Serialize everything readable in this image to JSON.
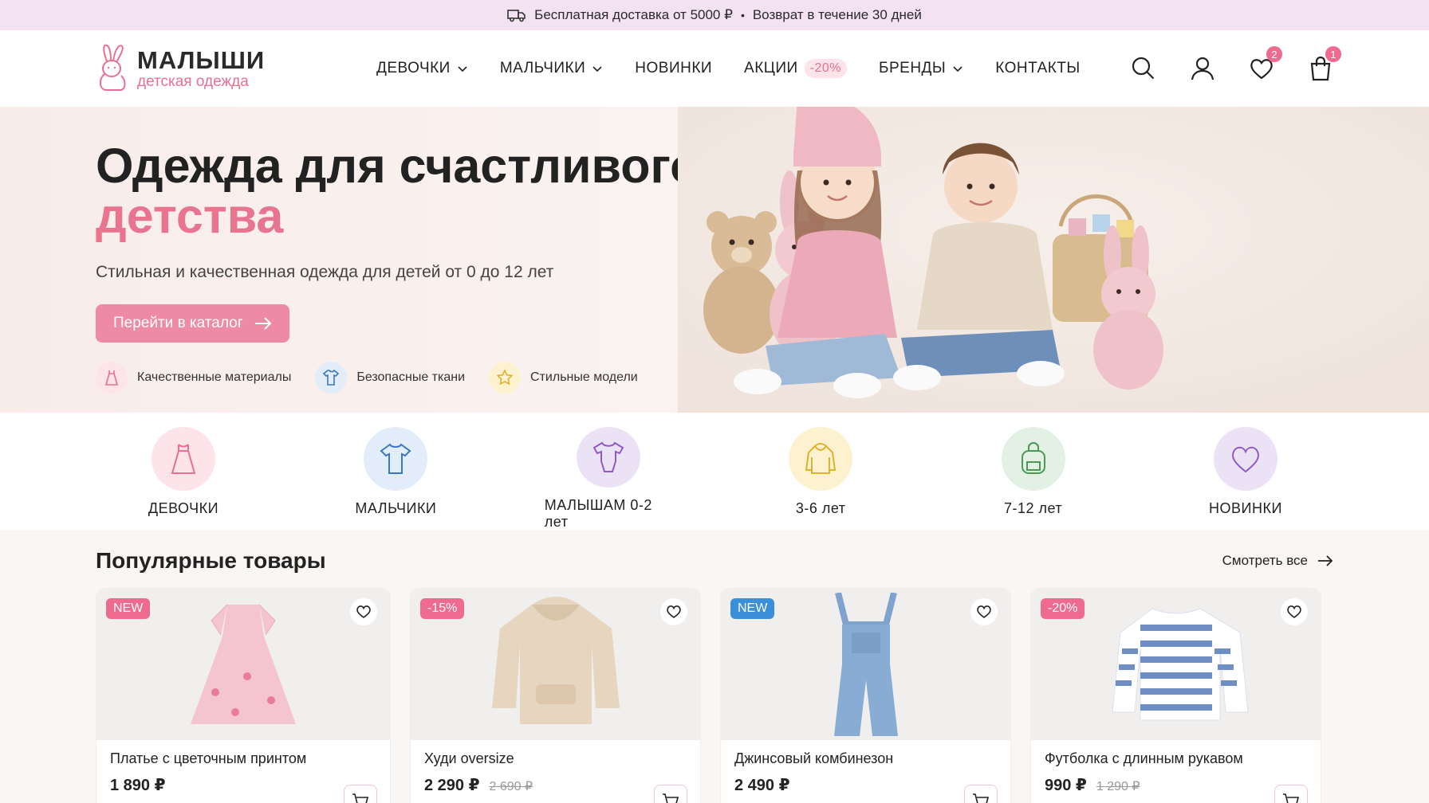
{
  "topbar": {
    "delivery": "Бесплатная доставка от 5000 ₽",
    "separator": "•",
    "returns": "Возврат в течение 30 дней"
  },
  "logo": {
    "name": "МАЛЫШИ",
    "tagline": "детская одежда"
  },
  "nav": {
    "items": [
      {
        "label": "ДЕВОЧКИ",
        "dropdown": true
      },
      {
        "label": "МАЛЬЧИКИ",
        "dropdown": true
      },
      {
        "label": "НОВИНКИ",
        "dropdown": false
      },
      {
        "label": "АКЦИИ",
        "dropdown": false,
        "tag": "-20%"
      },
      {
        "label": "БРЕНДЫ",
        "dropdown": true
      },
      {
        "label": "КОНТАКТЫ",
        "dropdown": false
      }
    ]
  },
  "header_icons": {
    "wishlist_count": "2",
    "cart_count": "1"
  },
  "hero": {
    "title_line1": "Одежда для счастливого",
    "title_line2": "детства",
    "lead": "Стильная и качественная одежда для детей от 0 до 12 лет",
    "cta": "Перейти в каталог",
    "features": [
      {
        "label": "Качественные материалы",
        "icon": "dress-icon"
      },
      {
        "label": "Безопасные ткани",
        "icon": "tshirt-icon"
      },
      {
        "label": "Стильные модели",
        "icon": "star-icon"
      }
    ]
  },
  "categories": [
    {
      "label": "ДЕВОЧКИ",
      "icon": "dress-icon",
      "bg": "#fde3ea",
      "stroke": "#e96f93"
    },
    {
      "label": "МАЛЬЧИКИ",
      "icon": "tshirt-icon",
      "bg": "#e2edf9",
      "stroke": "#3a78c2"
    },
    {
      "label": "МАЛЫШАМ 0-2 лет",
      "icon": "bodysuit-icon",
      "bg": "#ece2f6",
      "stroke": "#9058c8"
    },
    {
      "label": "3-6 лет",
      "icon": "hoodie-icon",
      "bg": "#fdf2cf",
      "stroke": "#e2b12c"
    },
    {
      "label": "7-12 лет",
      "icon": "backpack-icon",
      "bg": "#e2f1e3",
      "stroke": "#4a9a55"
    },
    {
      "label": "НОВИНКИ",
      "icon": "heart-icon",
      "bg": "#ece2f6",
      "stroke": "#9058c8"
    }
  ],
  "popular": {
    "title": "Популярные товары",
    "see_all": "Смотреть все",
    "products": [
      {
        "title": "Платье с цветочным принтом",
        "price": "1 890 ₽",
        "old_price": "",
        "tag": "NEW",
        "tag_color": "#ef6a8f"
      },
      {
        "title": "Худи oversize",
        "price": "2 290 ₽",
        "old_price": "2 690 ₽",
        "tag": "-15%",
        "tag_color": "#ef6a8f"
      },
      {
        "title": "Джинсовый комбинезон",
        "price": "2 490 ₽",
        "old_price": "",
        "tag": "NEW",
        "tag_color": "#3a8fd8"
      },
      {
        "title": "Футболка с длинным рукавом",
        "price": "990 ₽",
        "old_price": "1 290 ₽",
        "tag": "-20%",
        "tag_color": "#ef6a8f"
      }
    ]
  },
  "colors": {
    "accent": "#e96f93",
    "topbar_bg": "#f3e2f2",
    "cta_bg": "#ef8aa4"
  }
}
